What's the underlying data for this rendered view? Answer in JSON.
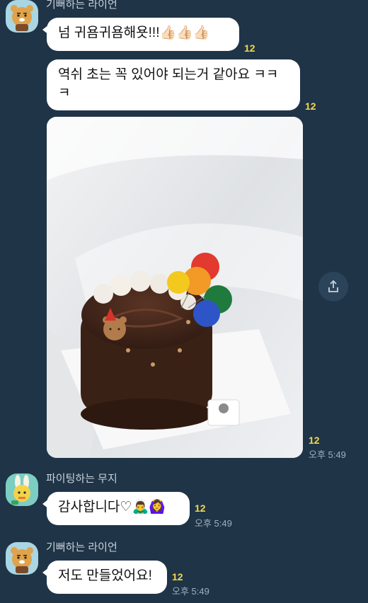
{
  "chat": {
    "messages": [
      {
        "sender": "기뻐하는 라이언",
        "text": "넘 귀욤귀욤해욧!!!",
        "emoji": "👍🏻👍🏻👍🏻",
        "unread": "12"
      },
      {
        "text": "역쉬 초는 꼭 있어야 되는거 같아요 ㅋㅋㅋ",
        "unread": "12"
      },
      {
        "type": "photo",
        "unread": "12",
        "time": "오후 5:49"
      },
      {
        "sender": "파이팅하는 무지",
        "text": "감사합니다♡",
        "emoji": "🙇‍♂️🙆‍♀️",
        "unread": "12",
        "time": "오후 5:49"
      },
      {
        "sender": "기뻐하는 라이언",
        "text": "저도 만들었어요!",
        "unread": "12",
        "time": "오후 5:49"
      }
    ]
  },
  "icons": {
    "share": "share-icon",
    "ryan": "ryan-avatar-icon",
    "muzi": "muzi-avatar-icon"
  }
}
